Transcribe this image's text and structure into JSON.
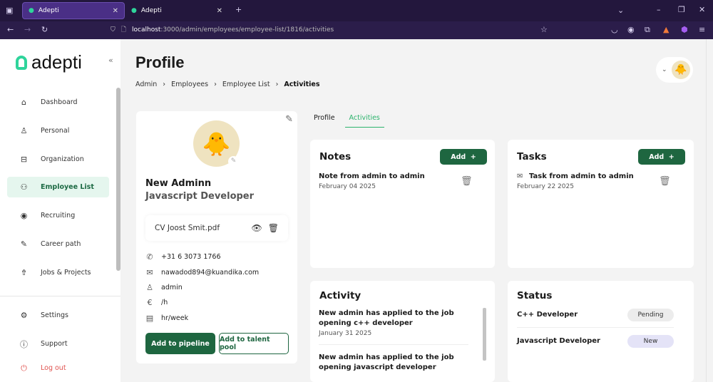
{
  "browser": {
    "tabs": [
      {
        "title": "Adepti"
      },
      {
        "title": "Adepti"
      }
    ],
    "url_host": "localhost",
    "url_path": ":3000/admin/employees/employee-list/1816/activities"
  },
  "sidebar": {
    "logo": "adepti",
    "items": [
      {
        "label": "Dashboard",
        "icon": "home-icon"
      },
      {
        "label": "Personal",
        "icon": "user-icon"
      },
      {
        "label": "Organization",
        "icon": "briefcase-icon"
      },
      {
        "label": "Employee List",
        "icon": "users-icon"
      },
      {
        "label": "Recruiting",
        "icon": "eye-icon"
      },
      {
        "label": "Career path",
        "icon": "pen-icon"
      },
      {
        "label": "Jobs & Projects",
        "icon": "upload-icon"
      }
    ],
    "bottom": [
      {
        "label": "Settings"
      },
      {
        "label": "Support"
      },
      {
        "label": "Log out"
      }
    ]
  },
  "header": {
    "title": "Profile",
    "breadcrumbs": [
      "Admin",
      "Employees",
      "Employee List",
      "Activities"
    ]
  },
  "profile": {
    "name": "New Adminn",
    "role": "Javascript Developer",
    "cv": "CV Joost Smit.pdf",
    "phone": "+31 6 3073 1766",
    "email": "nawadod894@kuandika.com",
    "username": "admin",
    "rate": "/h",
    "hours": "hr/week",
    "add_pipeline": "Add to pipeline",
    "add_talent": "Add to talent pool"
  },
  "tabs": {
    "profile": "Profile",
    "activities": "Activities"
  },
  "notes": {
    "title": "Notes",
    "add": "Add",
    "items": [
      {
        "title": "Note from admin to admin",
        "date": "February 04 2025"
      }
    ]
  },
  "tasks": {
    "title": "Tasks",
    "add": "Add",
    "items": [
      {
        "title": "Task from admin to admin",
        "date": "February 22 2025"
      }
    ]
  },
  "activity": {
    "title": "Activity",
    "items": [
      {
        "text": "New admin has applied to the job opening c++ developer",
        "date": "January 31 2025"
      },
      {
        "text": "New admin has applied to the job opening javascript developer"
      }
    ]
  },
  "status": {
    "title": "Status",
    "items": [
      {
        "job": "C++ Developer",
        "status": "Pending",
        "color": "#ececec"
      },
      {
        "job": "Javascript Developer",
        "status": "New",
        "color": "#e4e3f7"
      }
    ]
  },
  "colors": {
    "accent": "#1e6640",
    "highlight": "#e5f6ee"
  }
}
